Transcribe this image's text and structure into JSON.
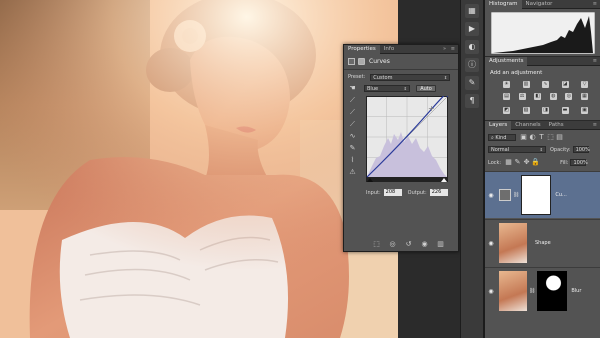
{
  "properties_panel": {
    "tabs": [
      "Properties",
      "Info"
    ],
    "adjustment_name": "Curves",
    "preset_label": "Preset:",
    "preset_value": "Custom",
    "channel_value": "Blue",
    "auto_label": "Auto",
    "input_label": "Input:",
    "input_value": "208",
    "output_label": "Output:",
    "output_value": "226"
  },
  "histogram_panel": {
    "tabs": [
      "Histogram",
      "Navigator"
    ]
  },
  "adjustments_panel": {
    "tab": "Adjustments",
    "heading": "Add an adjustment"
  },
  "layers_panel": {
    "tabs": [
      "Layers",
      "Channels",
      "Paths"
    ],
    "filter_label": "Kind",
    "blend_mode": "Normal",
    "opacity_label": "Opacity:",
    "opacity_value": "100%",
    "lock_label": "Lock:",
    "fill_label": "Fill:",
    "fill_value": "100%",
    "layers": [
      {
        "name": "Cu...",
        "selected": true
      },
      {
        "name": "Shape",
        "selected": false
      },
      {
        "name": "Blur",
        "selected": false
      }
    ]
  }
}
